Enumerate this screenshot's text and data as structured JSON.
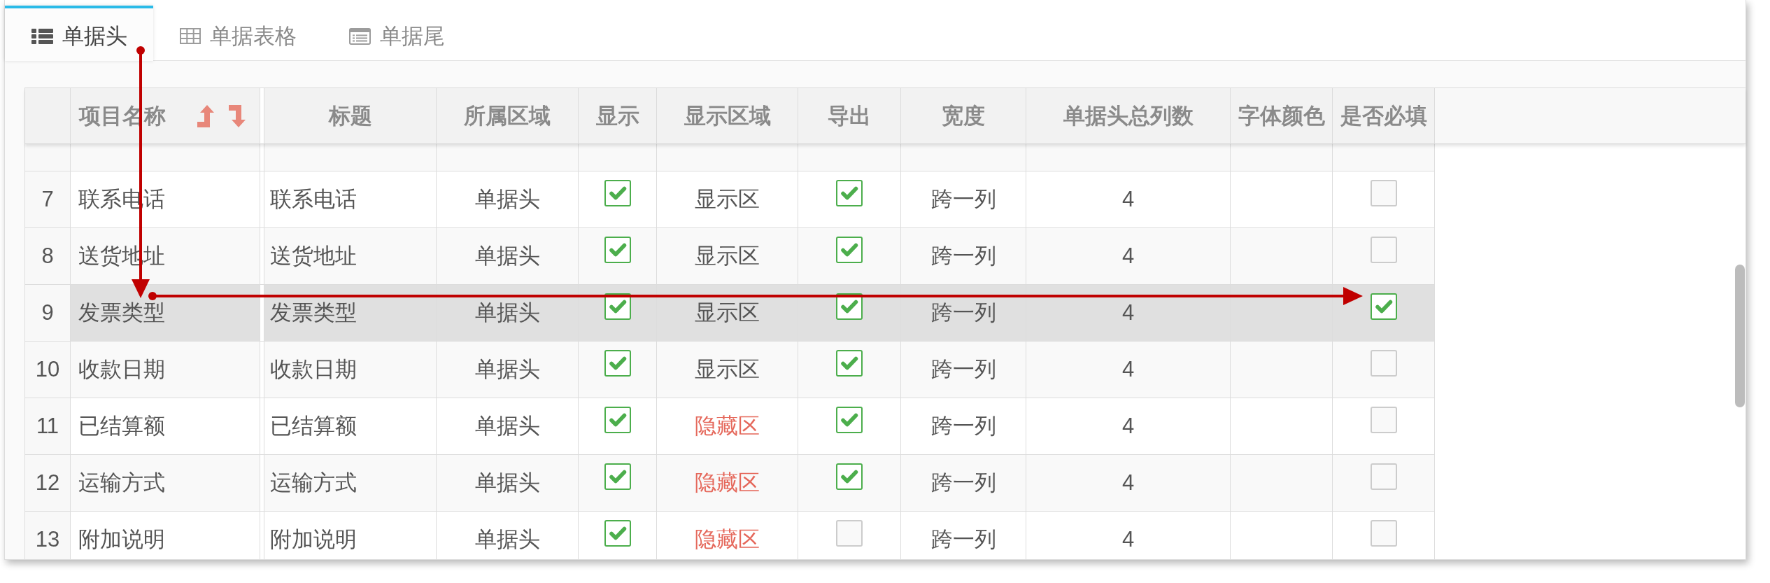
{
  "tabs": [
    {
      "label": "单据头",
      "selected": true
    },
    {
      "label": "单据表格",
      "selected": false
    },
    {
      "label": "单据尾",
      "selected": false
    }
  ],
  "table": {
    "columns": [
      {
        "label": "项目名称",
        "sortable": true
      },
      {
        "label": "标题",
        "sortable": false
      },
      {
        "label": "所属区域",
        "sortable": false
      },
      {
        "label": "显示",
        "sortable": false
      },
      {
        "label": "显示区域",
        "sortable": false
      },
      {
        "label": "导出",
        "sortable": false
      },
      {
        "label": "宽度",
        "sortable": false
      },
      {
        "label": "单据头总列数",
        "sortable": false
      },
      {
        "label": "字体颜色",
        "sortable": false
      },
      {
        "label": "是否必填",
        "sortable": false
      }
    ],
    "rows": [
      {
        "number": "7",
        "name": "联系电话",
        "title": "联系电话",
        "region": "单据头",
        "show": true,
        "display_area": {
          "text": "显示区",
          "kind": "shown"
        },
        "export": true,
        "width": "跨一列",
        "total_columns": "4",
        "required": false,
        "selected": false
      },
      {
        "number": "8",
        "name": "送货地址",
        "title": "送货地址",
        "region": "单据头",
        "show": true,
        "display_area": {
          "text": "显示区",
          "kind": "shown"
        },
        "export": true,
        "width": "跨一列",
        "total_columns": "4",
        "required": false,
        "selected": false
      },
      {
        "number": "9",
        "name": "发票类型",
        "title": "发票类型",
        "region": "单据头",
        "show": true,
        "display_area": {
          "text": "显示区",
          "kind": "shown"
        },
        "export": true,
        "width": "跨一列",
        "total_columns": "4",
        "required": true,
        "selected": true
      },
      {
        "number": "10",
        "name": "收款日期",
        "title": "收款日期",
        "region": "单据头",
        "show": true,
        "display_area": {
          "text": "显示区",
          "kind": "shown"
        },
        "export": true,
        "width": "跨一列",
        "total_columns": "4",
        "required": false,
        "selected": false
      },
      {
        "number": "11",
        "name": "已结算额",
        "title": "已结算额",
        "region": "单据头",
        "show": true,
        "display_area": {
          "text": "隐藏区",
          "kind": "hidden"
        },
        "export": true,
        "width": "跨一列",
        "total_columns": "4",
        "required": false,
        "selected": false
      },
      {
        "number": "12",
        "name": "运输方式",
        "title": "运输方式",
        "region": "单据头",
        "show": true,
        "display_area": {
          "text": "隐藏区",
          "kind": "hidden"
        },
        "export": true,
        "width": "跨一列",
        "total_columns": "4",
        "required": false,
        "selected": false
      },
      {
        "number": "13",
        "name": "附加说明",
        "title": "附加说明",
        "region": "单据头",
        "show": true,
        "display_area": {
          "text": "隐藏区",
          "kind": "hidden"
        },
        "export": false,
        "width": "跨一列",
        "total_columns": "4",
        "required": false,
        "selected": false
      }
    ]
  }
}
